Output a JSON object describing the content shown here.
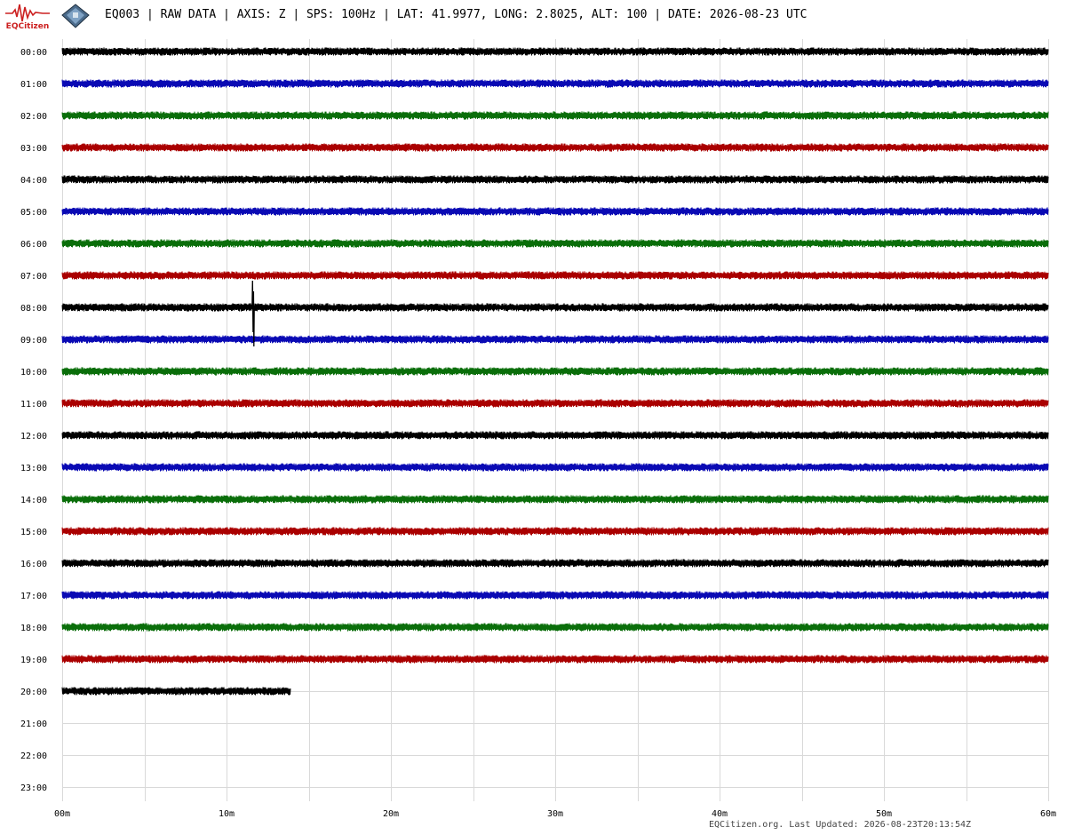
{
  "header": {
    "logo_text": "EQCitizen",
    "title": "EQ003 | RAW DATA | AXIS: Z | SPS: 100Hz | LAT: 41.9977, LONG: 2.8025, ALT: 100 | DATE: 2026-08-23 UTC"
  },
  "footer": {
    "updated": "EQCitizen.org. Last Updated: 2026-08-23T20:13:54Z"
  },
  "colors": {
    "cycle": [
      "#000000",
      "#0a0ab4",
      "#0a6e0a",
      "#aa0000"
    ],
    "grid": "#d9d9d9"
  },
  "icons": {
    "logo": "seismograph-logo-icon",
    "station": "sensor-board-icon"
  },
  "chart_data": {
    "type": "line",
    "description_kind": "helicorder",
    "rows": [
      "00:00",
      "01:00",
      "02:00",
      "03:00",
      "04:00",
      "05:00",
      "06:00",
      "07:00",
      "08:00",
      "09:00",
      "10:00",
      "11:00",
      "12:00",
      "13:00",
      "14:00",
      "15:00",
      "16:00",
      "17:00",
      "18:00",
      "19:00",
      "20:00",
      "21:00",
      "22:00",
      "23:00"
    ],
    "x_ticks": [
      "00m",
      "10m",
      "20m",
      "30m",
      "40m",
      "50m",
      "60m"
    ],
    "xlim": [
      0,
      60
    ],
    "x_unit": "minutes",
    "grid": true,
    "recorded_until_minutes": [
      60,
      60,
      60,
      60,
      60,
      60,
      60,
      60,
      60,
      60,
      60,
      60,
      60,
      60,
      60,
      60,
      60,
      60,
      60,
      60,
      13.9,
      0,
      0,
      0
    ],
    "events": [
      {
        "row": "08:00",
        "minute": 11.6
      }
    ]
  }
}
